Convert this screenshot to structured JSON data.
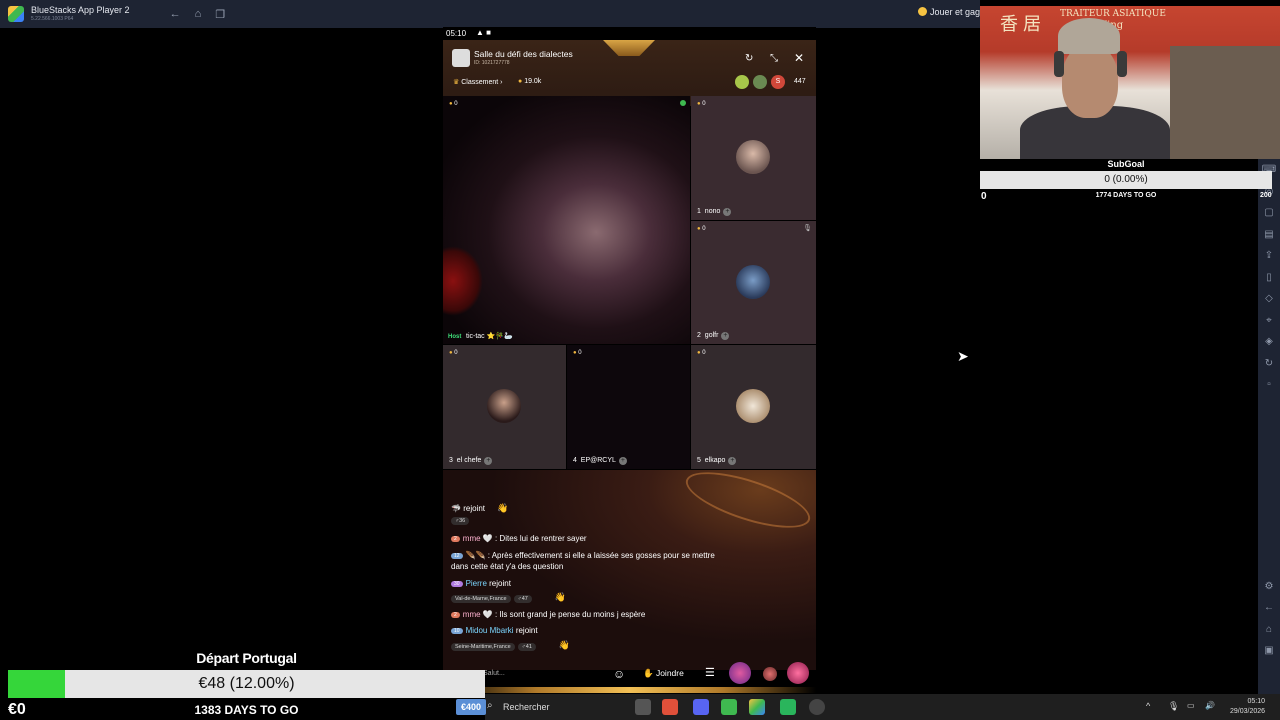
{
  "bluestacks": {
    "title": "BlueStacks App Player 2",
    "version": "5.22.566.1003 P64",
    "play_label": "Jouer et gag"
  },
  "phone": {
    "status_time": "05:10",
    "status_icons": "▲ ■",
    "room_title": "Salle du défi des dialectes",
    "room_id": "ID: 1021727778",
    "ranking_label": "Classement",
    "coins_value": "19.0k",
    "viewer_count": "447",
    "host": {
      "badge": "Host",
      "name": "tic-tac ⭐🎋🦢",
      "coins": "0"
    },
    "seats": [
      {
        "index": "1",
        "name": "nono",
        "coins": "0"
      },
      {
        "index": "2",
        "name": "golfr",
        "coins": "0"
      },
      {
        "index": "3",
        "name": "el chefe",
        "coins": "0"
      },
      {
        "index": "4",
        "name": "EP@RCYL",
        "coins": "0"
      },
      {
        "index": "5",
        "name": "elkapo",
        "coins": "0"
      }
    ],
    "chat": [
      {
        "user": "🦈",
        "text": "rejoint",
        "age": "♂36"
      },
      {
        "level": "2",
        "user": "mme 🤍",
        "text": ": Dites lui de rentrer sayer"
      },
      {
        "level": "12",
        "user": "🪶🪶",
        "text": ": Après effectivement si elle a laissée ses gosses pour se mettre",
        "text2": "dans cette état y'a des question"
      },
      {
        "level": "30",
        "user": "Pierre",
        "text": "rejoint",
        "location": "Val-de-Marne,France",
        "age": "♂47"
      },
      {
        "level": "2",
        "user": "mme 🤍",
        "text": ": Ils sont grand je pense du moins j espère"
      },
      {
        "level": "10",
        "user": "Midou Mbarki",
        "text": "rejoint",
        "location": "Seine-Maritime,France",
        "age": "♂41"
      }
    ],
    "say_hi": "Salut...",
    "join_label": "Joindre"
  },
  "webcam": {
    "sign_chinese": "香 居",
    "sign_line1": "TRAITEUR ASIATIQUE",
    "sign_line2": "Xing"
  },
  "subgoal": {
    "title": "SubGoal",
    "progress_text": "0 (0.00%)",
    "progress_fraction": 0.0,
    "start": "0",
    "days": "1774 DAYS TO GO",
    "target": "200"
  },
  "donation": {
    "title": "Départ Portugal",
    "progress_text": "€48 (12.00%)",
    "progress_fraction": 0.12,
    "start": "€0",
    "days": "1383 DAYS TO GO",
    "target_badge": "€400"
  },
  "taskbar": {
    "search_label": "Rechercher",
    "time": "05:10",
    "date": "29/03/2026"
  },
  "colors": {
    "progress_green": "#35d63a",
    "bluestacks_chrome": "#1e2433",
    "gold": "#f0b740"
  }
}
